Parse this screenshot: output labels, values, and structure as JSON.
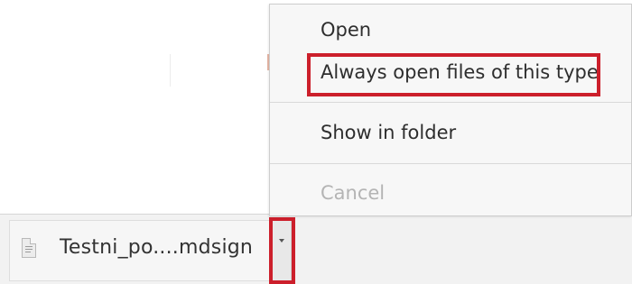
{
  "download_shelf": {
    "file_name": "Testni_po....mdsign",
    "file_icon": "document-icon",
    "arrow_icon": "chevron-down-icon"
  },
  "context_menu": {
    "items": [
      {
        "label": "Open",
        "enabled": true
      },
      {
        "label": "Always open files of this type",
        "enabled": true
      },
      {
        "label": "Show in folder",
        "enabled": true
      },
      {
        "label": "Cancel",
        "enabled": false
      }
    ]
  },
  "annotations": {
    "highlight_color": "#cc1f2b",
    "highlighted_targets": [
      "always-open-menu-item",
      "download-dropdown-button"
    ]
  }
}
